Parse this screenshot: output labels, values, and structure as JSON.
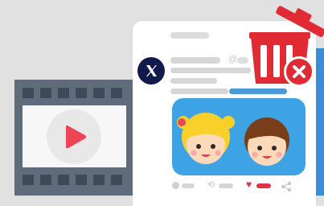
{
  "post": {
    "handle_prefix": "@",
    "social_logo_icon": "x-logo-icon"
  },
  "icons": {
    "video": "video-film-icon",
    "play": "play-icon",
    "trash": "trash-can-icon",
    "delete": "delete-x-icon",
    "comment": "comment-icon",
    "retweet": "retweet-icon",
    "like": "heart-icon",
    "share": "share-icon"
  },
  "colors": {
    "background": "#e1e1e1",
    "card": "#ffffff",
    "accent_blue": "#3b8ed6",
    "trash_red": "#e02b34",
    "like_red": "#e0324a",
    "play_red": "#ef4453",
    "film_dark": "#5e6c7b"
  }
}
